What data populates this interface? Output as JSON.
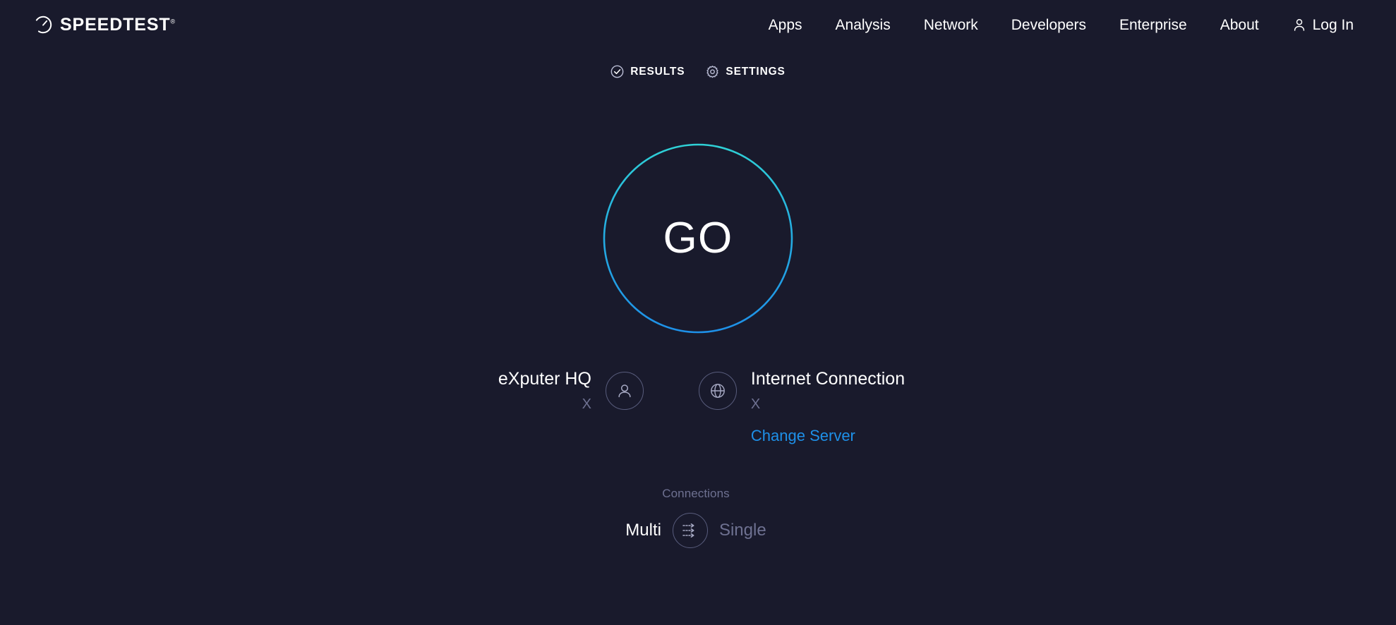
{
  "header": {
    "brand_name": "SPEEDTEST",
    "brand_tm": "®",
    "brand_icon": "speedometer-icon",
    "nav": [
      {
        "label": "Apps"
      },
      {
        "label": "Analysis"
      },
      {
        "label": "Network"
      },
      {
        "label": "Developers"
      },
      {
        "label": "Enterprise"
      },
      {
        "label": "About"
      }
    ],
    "login": {
      "label": "Log In",
      "icon": "person-icon"
    }
  },
  "tabs": [
    {
      "label": "RESULTS",
      "icon": "check-circle-icon"
    },
    {
      "label": "SETTINGS",
      "icon": "gear-icon"
    }
  ],
  "go": {
    "label": "GO",
    "ring_color_top": "#2fd1d6",
    "ring_color_bottom": "#1e90e8"
  },
  "server": {
    "client": {
      "name": "eXputer HQ",
      "sub": "X",
      "icon": "person-icon"
    },
    "isp": {
      "name": "Internet Connection",
      "sub": "X",
      "icon": "globe-icon",
      "change_server_label": "Change Server"
    }
  },
  "connections": {
    "label": "Connections",
    "multi_label": "Multi",
    "single_label": "Single",
    "toggle_icon": "multi-arrows-icon",
    "selected": "Multi"
  },
  "colors": {
    "background": "#191a2c",
    "accent_blue": "#1e90e8",
    "accent_teal": "#2fd1d6",
    "muted_text": "#6e7191"
  }
}
